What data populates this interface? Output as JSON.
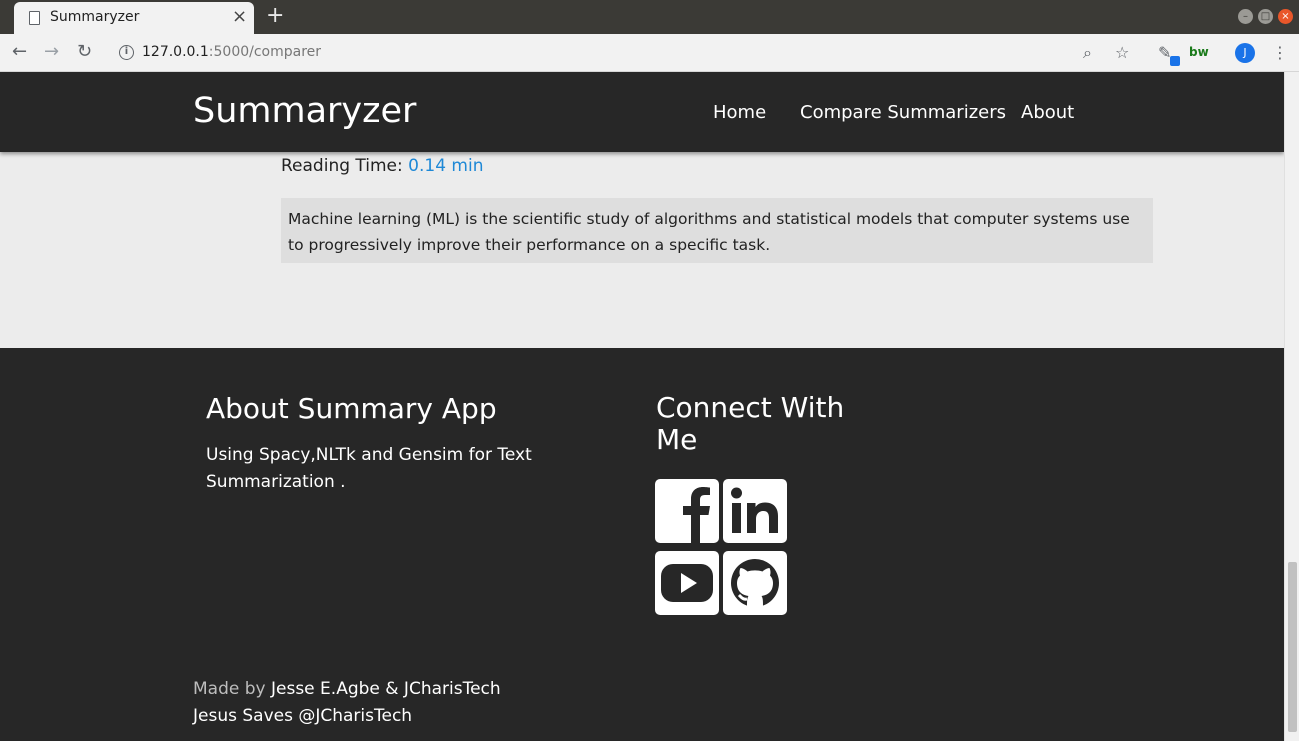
{
  "browser": {
    "tab_title": "Summaryzer",
    "tab_close": "×",
    "new_tab": "+",
    "url_host": "127.0.0.1",
    "url_path": ":5000/comparer",
    "avatar_letter": "J",
    "extension_label": "bw"
  },
  "navbar": {
    "brand": "Summaryzer",
    "links": [
      "Home",
      "Compare Summarizers",
      "About"
    ]
  },
  "result": {
    "reading_label": "Reading Time:",
    "reading_value": "0.14 min",
    "summary_text": "Machine learning (ML) is the scientific study of algorithms and statistical models that computer systems use to progressively improve their performance on a specific task."
  },
  "footer": {
    "about_title": "About Summary App",
    "about_text": "Using Spacy,NLTk and Gensim for Text Summarization .",
    "connect_title": "Connect With Me",
    "social": [
      "facebook-icon",
      "linkedin-icon",
      "youtube-icon",
      "github-icon"
    ],
    "made_by_label": "Made by",
    "made_by_names": "Jesse E.Agbe & JCharisTech",
    "tagline": "Jesus Saves @JCharisTech"
  },
  "colors": {
    "navbar_bg": "#272727",
    "accent_link": "#1e88d6",
    "page_bg": "#ececec"
  }
}
